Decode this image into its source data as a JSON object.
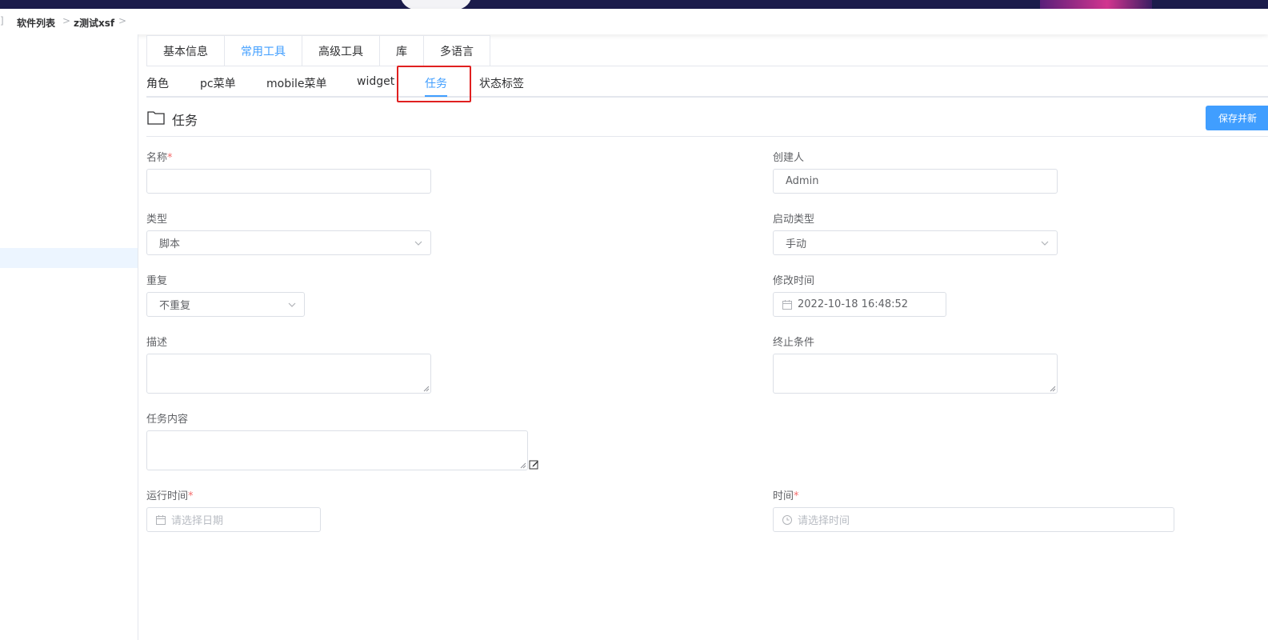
{
  "breadcrumb": {
    "items": [
      "软件列表",
      "z测试xsf"
    ]
  },
  "main_tabs": [
    {
      "label": "基本信息",
      "active": false
    },
    {
      "label": "常用工具",
      "active": true
    },
    {
      "label": "高级工具",
      "active": false
    },
    {
      "label": "库",
      "active": false
    },
    {
      "label": "多语言",
      "active": false
    }
  ],
  "sub_tabs": [
    {
      "label": "角色",
      "active": false
    },
    {
      "label": "pc菜单",
      "active": false
    },
    {
      "label": "mobile菜单",
      "active": false
    },
    {
      "label": "widget",
      "active": false
    },
    {
      "label": "任务",
      "active": true
    },
    {
      "label": "状态标签",
      "active": false
    }
  ],
  "section": {
    "title": "任务",
    "save_button": "保存并新"
  },
  "form": {
    "name": {
      "label": "名称",
      "required_mark": "*",
      "value": ""
    },
    "creator": {
      "label": "创建人",
      "value": "Admin"
    },
    "type": {
      "label": "类型",
      "value": "脚本"
    },
    "start_type": {
      "label": "启动类型",
      "value": "手动"
    },
    "repeat": {
      "label": "重复",
      "value": "不重复"
    },
    "modified_time": {
      "label": "修改时间",
      "value": "2022-10-18 16:48:52"
    },
    "description": {
      "label": "描述",
      "value": ""
    },
    "stop_condition": {
      "label": "终止条件",
      "value": ""
    },
    "task_content": {
      "label": "任务内容",
      "value": ""
    },
    "run_date": {
      "label": "运行时间",
      "required_mark": "*",
      "placeholder": "请选择日期"
    },
    "time": {
      "label": "时间",
      "required_mark": "*",
      "placeholder": "请选择时间"
    }
  },
  "colors": {
    "accent": "#409eff",
    "required": "#f56c6c",
    "highlight": "#e02020",
    "banner": "#1b1c4b"
  }
}
